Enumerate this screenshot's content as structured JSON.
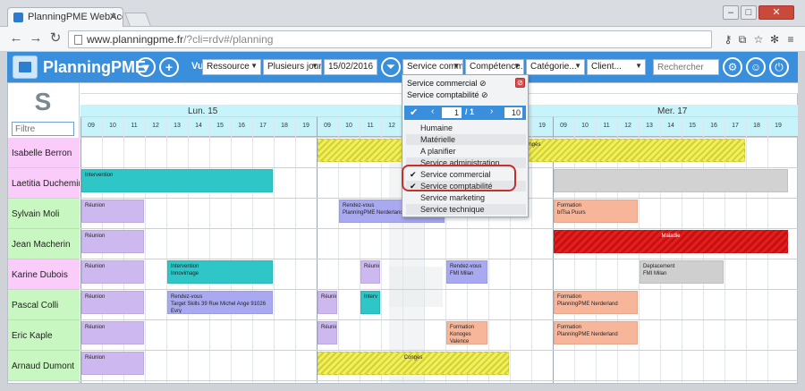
{
  "browser": {
    "tab_title": "PlanningPME WebAccess",
    "url_host": "www.planningpme.fr",
    "url_path": "/?cli=rdv#/planning"
  },
  "header": {
    "app_title": "PlanningPME",
    "vue_label": "Vue",
    "view_select": "Ressource",
    "period_select": "Plusieurs jour",
    "date_input": "15/02/2016",
    "service_select": "Service comm",
    "skill_select": "Compétence...",
    "category_select": "Catégorie...",
    "client_select": "Client...",
    "search_placeholder": "Rechercher"
  },
  "left": {
    "filter_placeholder": "Filtre",
    "people": [
      {
        "name": "Isabelle Berron",
        "color": "#f9ccf9"
      },
      {
        "name": "Laetitia Duchemin",
        "color": "#f9ccf9"
      },
      {
        "name": "Sylvain Moli",
        "color": "#c9f7c2"
      },
      {
        "name": "Jean Macherin",
        "color": "#c9f7c2"
      },
      {
        "name": "Karine Dubois",
        "color": "#f9ccf9"
      },
      {
        "name": "Pascal Colli",
        "color": "#c9f7c2"
      },
      {
        "name": "Eric Kaple",
        "color": "#c9f7c2"
      },
      {
        "name": "Arnaud Dumont",
        "color": "#c9f7c2"
      }
    ]
  },
  "calendar": {
    "days": [
      "Lun. 15",
      "Mer. 17"
    ],
    "hours": [
      "09",
      "10",
      "11",
      "12",
      "13",
      "14",
      "15",
      "16",
      "17",
      "18",
      "19",
      "09",
      "10",
      "11",
      "12",
      "13",
      "14",
      "15",
      "16",
      "17",
      "18",
      "19",
      "09",
      "10",
      "11",
      "12",
      "13",
      "14",
      "15",
      "16",
      "17",
      "18",
      "19"
    ]
  },
  "events": [
    {
      "row": 0,
      "start": 11,
      "end": 31,
      "style": "yellow",
      "lines": [
        "Congés"
      ]
    },
    {
      "row": 1,
      "start": 0,
      "end": 9,
      "style": "teal",
      "lines": [
        "Intervention"
      ]
    },
    {
      "row": 1,
      "start": 22,
      "end": 33,
      "style": "lightgray",
      "lines": [
        ""
      ]
    },
    {
      "row": 2,
      "start": 0,
      "end": 3,
      "style": "purple",
      "lines": [
        "Réunion"
      ]
    },
    {
      "row": 2,
      "start": 12,
      "end": 17,
      "style": "blue",
      "lines": [
        "Rendez-vous",
        "PlanningPME Nerderland"
      ]
    },
    {
      "row": 2,
      "start": 22,
      "end": 26,
      "style": "orange",
      "lines": [
        "Formation",
        "bITsa Puurs"
      ]
    },
    {
      "row": 3,
      "start": 0,
      "end": 3,
      "style": "purple",
      "lines": [
        "Réunion"
      ]
    },
    {
      "row": 3,
      "start": 22,
      "end": 33,
      "style": "red",
      "lines": [
        "Maladie"
      ]
    },
    {
      "row": 4,
      "start": 0,
      "end": 3,
      "style": "purple",
      "lines": [
        "Réunion"
      ]
    },
    {
      "row": 4,
      "start": 4,
      "end": 9,
      "style": "teal",
      "lines": [
        "Intervention",
        "Innovimage"
      ]
    },
    {
      "row": 4,
      "start": 13,
      "end": 14,
      "style": "purple",
      "lines": [
        "Réunion"
      ]
    },
    {
      "row": 4,
      "start": 17,
      "end": 19,
      "style": "blue",
      "lines": [
        "Rendez-vous",
        "FMI Milan"
      ]
    },
    {
      "row": 4,
      "start": 26,
      "end": 30,
      "style": "gray",
      "lines": [
        "Deplacement",
        "FMI Milan"
      ]
    },
    {
      "row": 5,
      "start": 0,
      "end": 3,
      "style": "purple",
      "lines": [
        "Réunion"
      ]
    },
    {
      "row": 5,
      "start": 4,
      "end": 9,
      "style": "blue",
      "lines": [
        "Rendez-vous",
        "Target Skills 39 Rue Michel Ange 91026",
        "Evry"
      ]
    },
    {
      "row": 5,
      "start": 11,
      "end": 12,
      "style": "purple",
      "lines": [
        "Réunion"
      ]
    },
    {
      "row": 5,
      "start": 13,
      "end": 14,
      "style": "teal",
      "lines": [
        "Interv"
      ]
    },
    {
      "row": 5,
      "start": 22,
      "end": 26,
      "style": "orange",
      "lines": [
        "Formation",
        "PlanningPME Nerderland"
      ]
    },
    {
      "row": 6,
      "start": 0,
      "end": 3,
      "style": "purple",
      "lines": [
        "Réunion"
      ]
    },
    {
      "row": 6,
      "start": 11,
      "end": 12,
      "style": "purple",
      "lines": [
        "Réunion"
      ]
    },
    {
      "row": 6,
      "start": 17,
      "end": 19,
      "style": "orange",
      "lines": [
        "Formation",
        "Konoges Valence"
      ]
    },
    {
      "row": 6,
      "start": 22,
      "end": 26,
      "style": "orange",
      "lines": [
        "Formation",
        "PlanningPME Nerderland"
      ]
    },
    {
      "row": 7,
      "start": 0,
      "end": 3,
      "style": "purple",
      "lines": [
        "Réunion"
      ]
    },
    {
      "row": 7,
      "start": 11,
      "end": 20,
      "style": "yellow",
      "lines": [
        "Congés"
      ]
    }
  ],
  "dropdown": {
    "selected": [
      "Service commercial",
      "Service comptabilité"
    ],
    "page": "1",
    "total": "/ 1",
    "page_size": "10",
    "items": [
      {
        "label": "Humaine",
        "checked": false
      },
      {
        "label": "Matérielle",
        "checked": false
      },
      {
        "label": "A planifier",
        "checked": false
      },
      {
        "label": "Service administration",
        "checked": false
      },
      {
        "label": "Service commercial",
        "checked": true
      },
      {
        "label": "Service comptabilité",
        "checked": true
      },
      {
        "label": "Service marketing",
        "checked": false
      },
      {
        "label": "Service technique",
        "checked": false
      }
    ]
  },
  "icons": {
    "back": "back-arrow-icon",
    "forward": "forward-arrow-icon",
    "reload": "reload-icon",
    "settings": "gear-icon",
    "user": "user-icon",
    "power": "power-icon",
    "filter": "funnel-icon",
    "view_down": "chevron-down-icon",
    "add": "plus-icon"
  }
}
